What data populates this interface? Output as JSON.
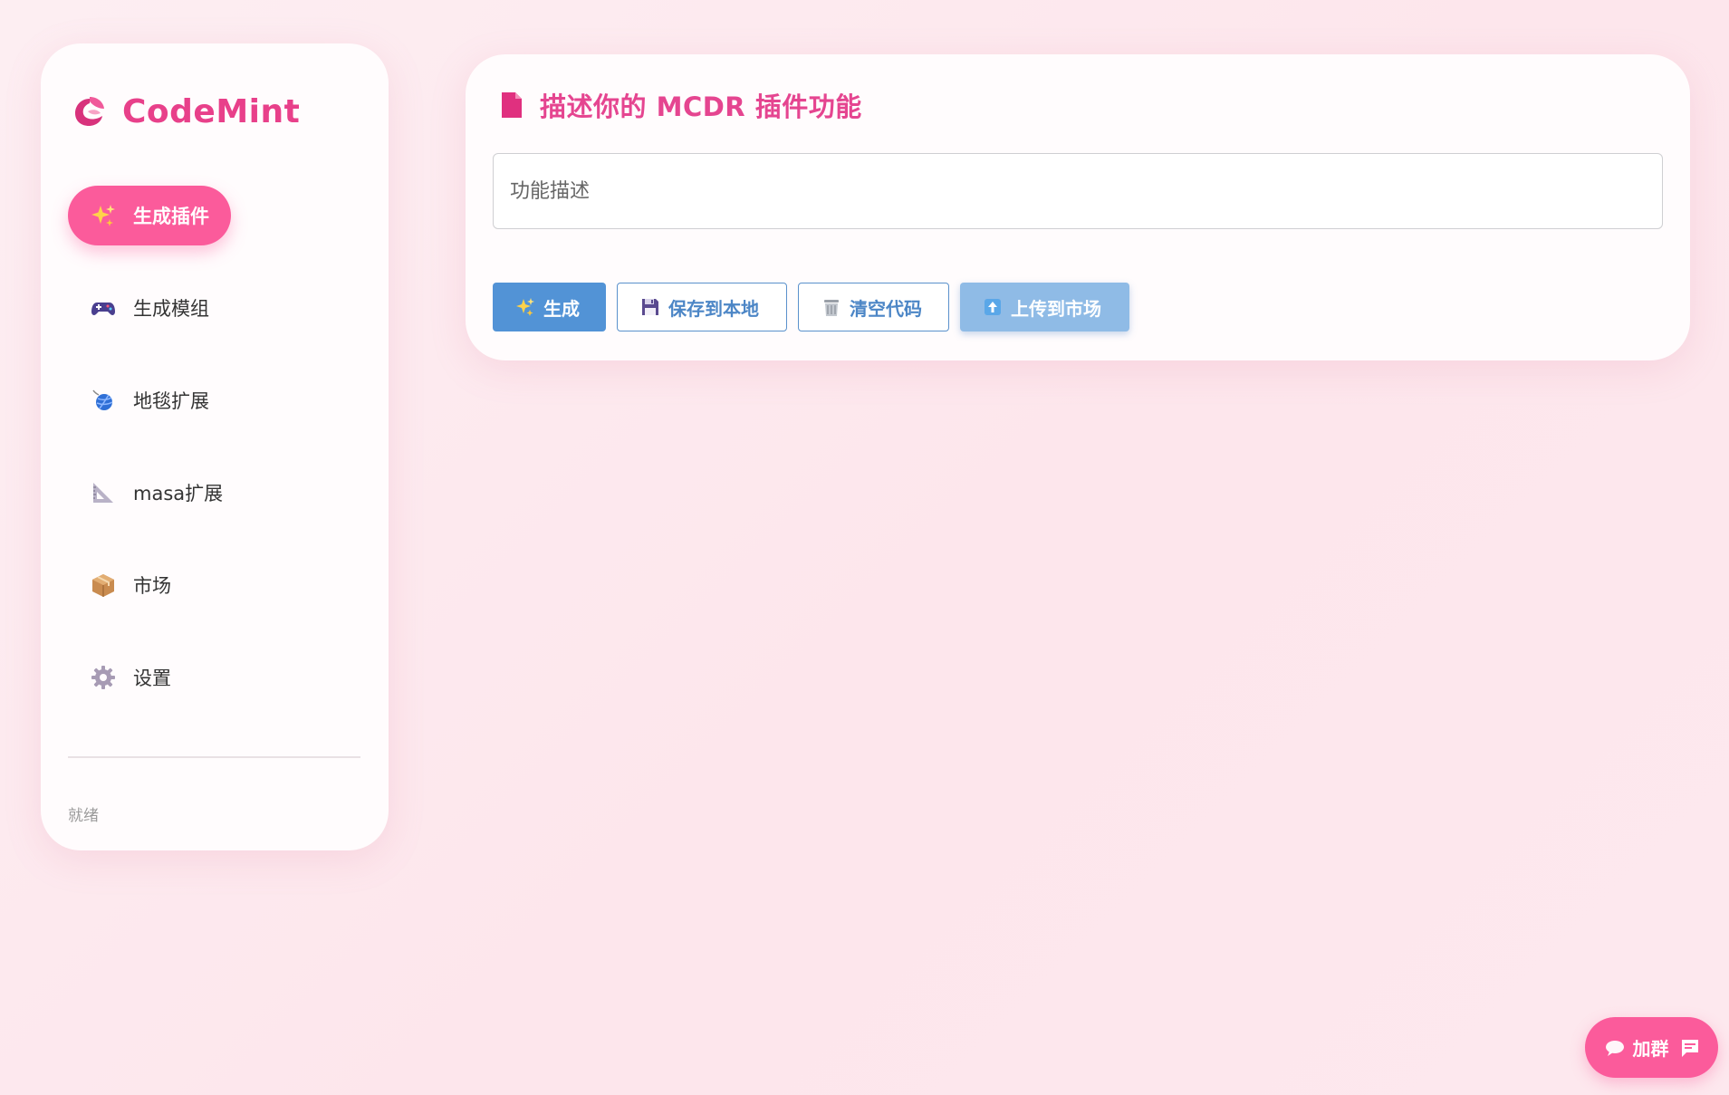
{
  "app": {
    "brand_name": "CodeMint",
    "brand_color": "#e8408a",
    "accent_color": "#fb5b9b",
    "primary_blue": "#5293d6"
  },
  "sidebar": {
    "items": [
      {
        "label": "生成插件",
        "icon": "sparkles-icon",
        "active": true
      },
      {
        "label": "生成模组",
        "icon": "gamepad-icon",
        "active": false
      },
      {
        "label": "地毯扩展",
        "icon": "yarn-ball-icon",
        "active": false
      },
      {
        "label": "masa扩展",
        "icon": "triangle-ruler-icon",
        "active": false
      },
      {
        "label": "市场",
        "icon": "package-icon",
        "active": false
      },
      {
        "label": "设置",
        "icon": "gear-icon",
        "active": false
      }
    ],
    "status": "就绪"
  },
  "main": {
    "title": "描述你的 MCDR 插件功能",
    "description_placeholder": "功能描述",
    "buttons": {
      "generate": "生成",
      "save": "保存到本地",
      "clear": "清空代码",
      "upload": "上传到市场"
    }
  },
  "floating": {
    "join_label": "加群"
  }
}
